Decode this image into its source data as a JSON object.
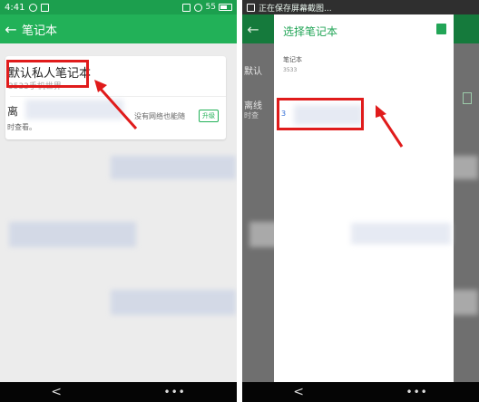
{
  "left": {
    "status": {
      "time": "4:41",
      "battery": "55"
    },
    "appbar": {
      "back": "←",
      "title": "笔记本"
    },
    "card": {
      "notebook_name": "默认私人笔记本",
      "notebook_sub": "3533手机世界",
      "line_a": "离",
      "line_b": "没有网络也能随",
      "line_c": "时查看。",
      "upgrade": "升级"
    },
    "nav": {
      "back": "<",
      "menu": "•••"
    }
  },
  "right": {
    "status": {
      "text": "正在保存屏幕截图..."
    },
    "appbar": {
      "back": "←"
    },
    "dialog": {
      "title": "选择笔记本",
      "section": "笔记本",
      "sub": "3533",
      "item_num": "3"
    },
    "peek": {
      "a": "默认",
      "b": "离线",
      "c": "时查"
    },
    "nav": {
      "back": "<",
      "menu": "•••"
    }
  },
  "colors": {
    "green": "#22b158",
    "dark_green": "#1c9f4e",
    "red": "#e01b1b"
  }
}
